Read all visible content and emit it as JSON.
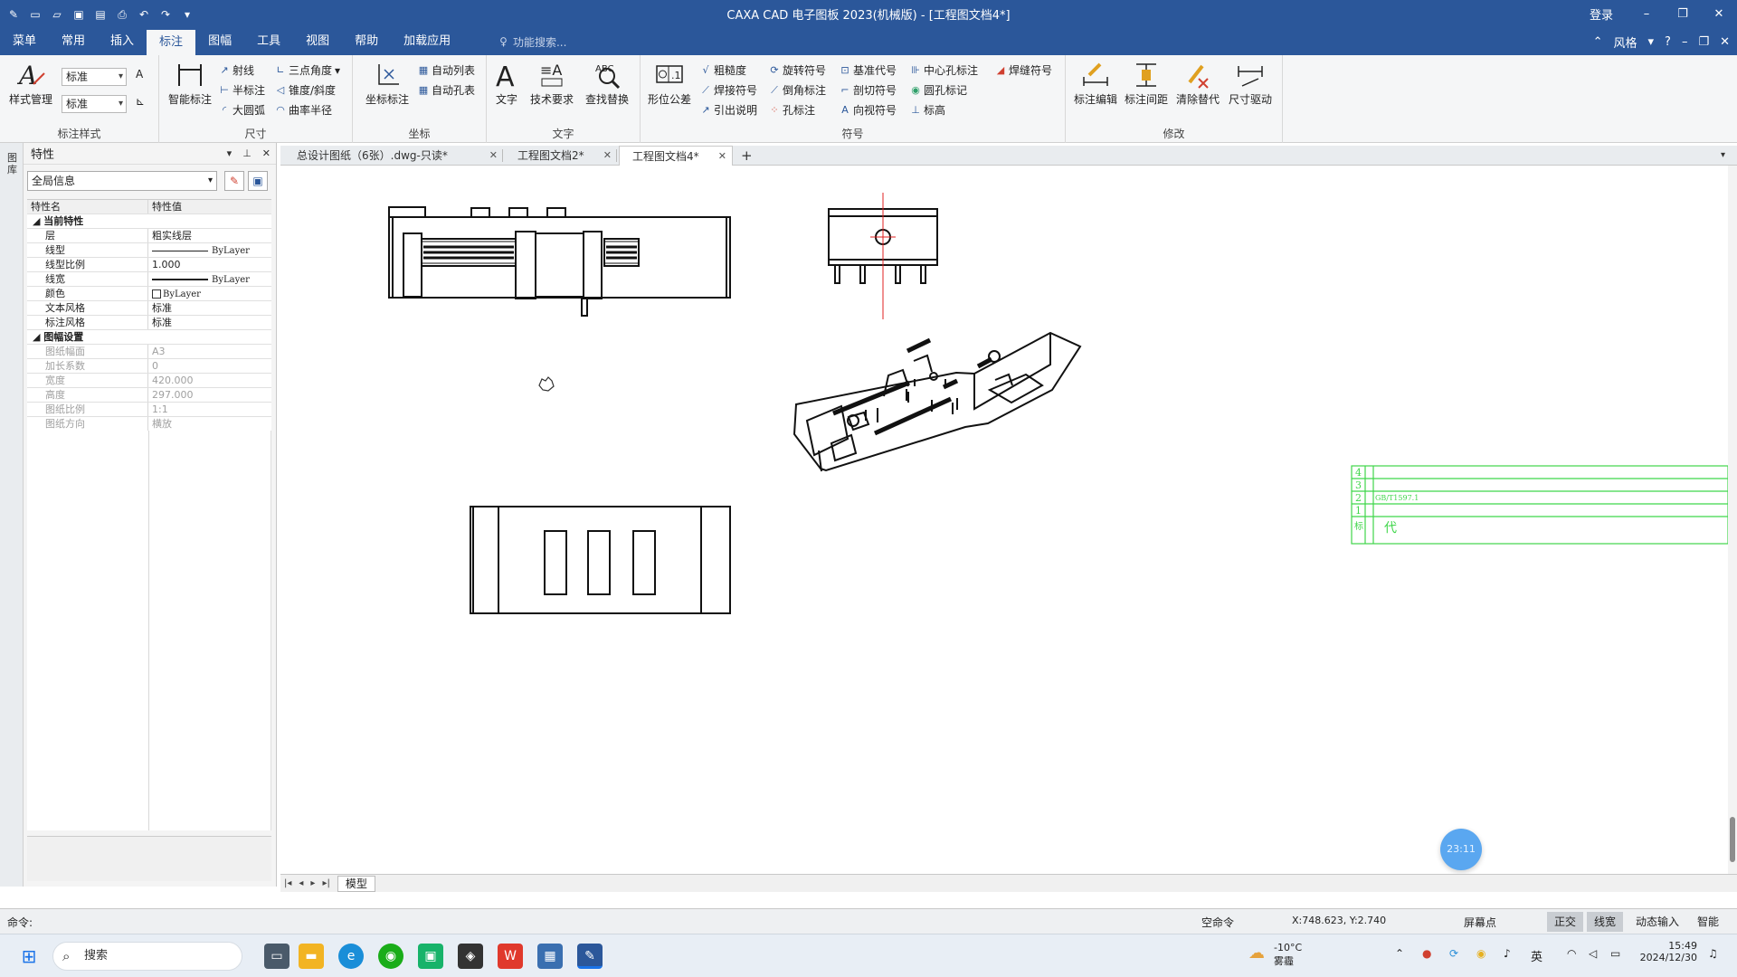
{
  "window": {
    "title": "CAXA CAD 电子图板 2023(机械版) - [工程图文档4*]",
    "login": "登录"
  },
  "menu": {
    "items": [
      "菜单",
      "常用",
      "插入",
      "标注",
      "图幅",
      "工具",
      "视图",
      "帮助",
      "加载应用"
    ],
    "search_placeholder": "功能搜索...",
    "style_label": "风格"
  },
  "ribbon": {
    "style_group": {
      "label": "标注样式",
      "style_manage": "样式管理",
      "combo1": "标准",
      "combo2": "标准"
    },
    "dim_group": {
      "label": "尺寸",
      "smart": "智能标注",
      "ray": "射线",
      "half": "半标注",
      "arc": "大圆弧",
      "three_angle": "三点角度",
      "taper": "锥度/斜度",
      "curvature": "曲率半径"
    },
    "coord_group": {
      "label": "坐标",
      "coord": "坐标标注",
      "auto_list": "自动列表",
      "auto_hole": "自动孔表"
    },
    "text_group": {
      "label": "文字",
      "text": "文字",
      "tech": "技术要求",
      "find": "查找替换"
    },
    "symbol_group": {
      "label": "符号",
      "tol": "形位公差",
      "rough": "粗糙度",
      "weld": "焊接符号",
      "leader": "引出说明",
      "rotate": "旋转符号",
      "chamfer": "倒角标注",
      "hole": "孔标注",
      "datum": "基准代号",
      "section": "剖切符号",
      "view": "向视符号",
      "center_hole": "中心孔标注",
      "round_hole": "圆孔标记",
      "elevation": "标高",
      "weld_sym": "焊缝符号"
    },
    "modify_group": {
      "label": "修改",
      "edit": "标注编辑",
      "spacing": "标注间距",
      "clear": "清除替代",
      "drive": "尺寸驱动"
    }
  },
  "left_strip": {
    "text": "图库"
  },
  "properties": {
    "title": "特性",
    "scope": "全局信息",
    "col_name": "特性名",
    "col_value": "特性值",
    "section1": "当前特性",
    "rows1": [
      {
        "k": "层",
        "v": "粗实线层"
      },
      {
        "k": "线型",
        "v": "ByLayer"
      },
      {
        "k": "线型比例",
        "v": "1.000"
      },
      {
        "k": "线宽",
        "v": "ByLayer"
      },
      {
        "k": "颜色",
        "v": "ByLayer"
      },
      {
        "k": "文本风格",
        "v": "标准"
      },
      {
        "k": "标注风格",
        "v": "标准"
      }
    ],
    "section2": "图幅设置",
    "rows2": [
      {
        "k": "图纸幅面",
        "v": "A3"
      },
      {
        "k": "加长系数",
        "v": "0"
      },
      {
        "k": "宽度",
        "v": "420.000"
      },
      {
        "k": "高度",
        "v": "297.000"
      },
      {
        "k": "图纸比例",
        "v": "1:1"
      },
      {
        "k": "图纸方向",
        "v": "横放"
      }
    ]
  },
  "tabs": [
    {
      "label": "总设计图纸（6张）.dwg-只读*"
    },
    {
      "label": "工程图文档2*"
    },
    {
      "label": "工程图文档4*"
    }
  ],
  "sheet": {
    "model": "模型"
  },
  "title_block": {
    "rows": [
      "4",
      "3",
      "2",
      "1"
    ],
    "std": "GB/T1597.1",
    "char_a": "标",
    "char_b": "代"
  },
  "bubble": {
    "time": "23:11"
  },
  "status": {
    "cmd_label": "命令:",
    "cmd_state": "空命令",
    "coords": "X:748.623, Y:2.740",
    "snap": "屏幕点",
    "ortho": "正交",
    "lw": "线宽",
    "dyn": "动态输入",
    "smart": "智能"
  },
  "taskbar": {
    "search": "搜索",
    "weather_temp": "-10°C",
    "weather_desc": "雾霾",
    "ime": "英",
    "time": "15:49",
    "date": "2024/12/30"
  },
  "colors": {
    "accent": "#2b579a",
    "titleblock": "#3fd64a",
    "centerline": "#e02020"
  }
}
